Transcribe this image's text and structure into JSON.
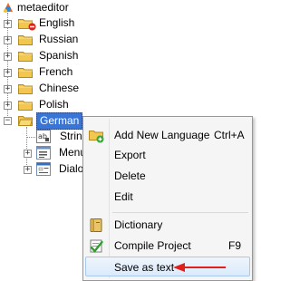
{
  "tree": {
    "root_label": "metaeditor",
    "languages": [
      {
        "label": "English",
        "selected": false
      },
      {
        "label": "Russian",
        "selected": false
      },
      {
        "label": "Spanish",
        "selected": false
      },
      {
        "label": "French",
        "selected": false
      },
      {
        "label": "Chinese",
        "selected": false
      },
      {
        "label": "Polish",
        "selected": false
      },
      {
        "label": "German",
        "selected": true
      }
    ],
    "children": [
      "Strings",
      "Menus",
      "Dialogs"
    ]
  },
  "context_menu": {
    "items": [
      {
        "label": "Add New Language",
        "shortcut": "Ctrl+A",
        "icon": "add-folder-icon"
      },
      {
        "label": "Export",
        "shortcut": "",
        "icon": ""
      },
      {
        "label": "Delete",
        "shortcut": "",
        "icon": ""
      },
      {
        "label": "Edit",
        "shortcut": "",
        "icon": ""
      },
      {
        "label": "Dictionary",
        "shortcut": "",
        "icon": "dictionary-icon"
      },
      {
        "label": "Compile Project",
        "shortcut": "F9",
        "icon": "compile-check-icon"
      },
      {
        "label": "Save as text",
        "shortcut": "",
        "icon": ""
      }
    ],
    "hovered_item": "Save as text",
    "arrow_color": "#e0201b"
  },
  "colors": {
    "selection": "#3875d7",
    "folder": "#f3c64f"
  }
}
